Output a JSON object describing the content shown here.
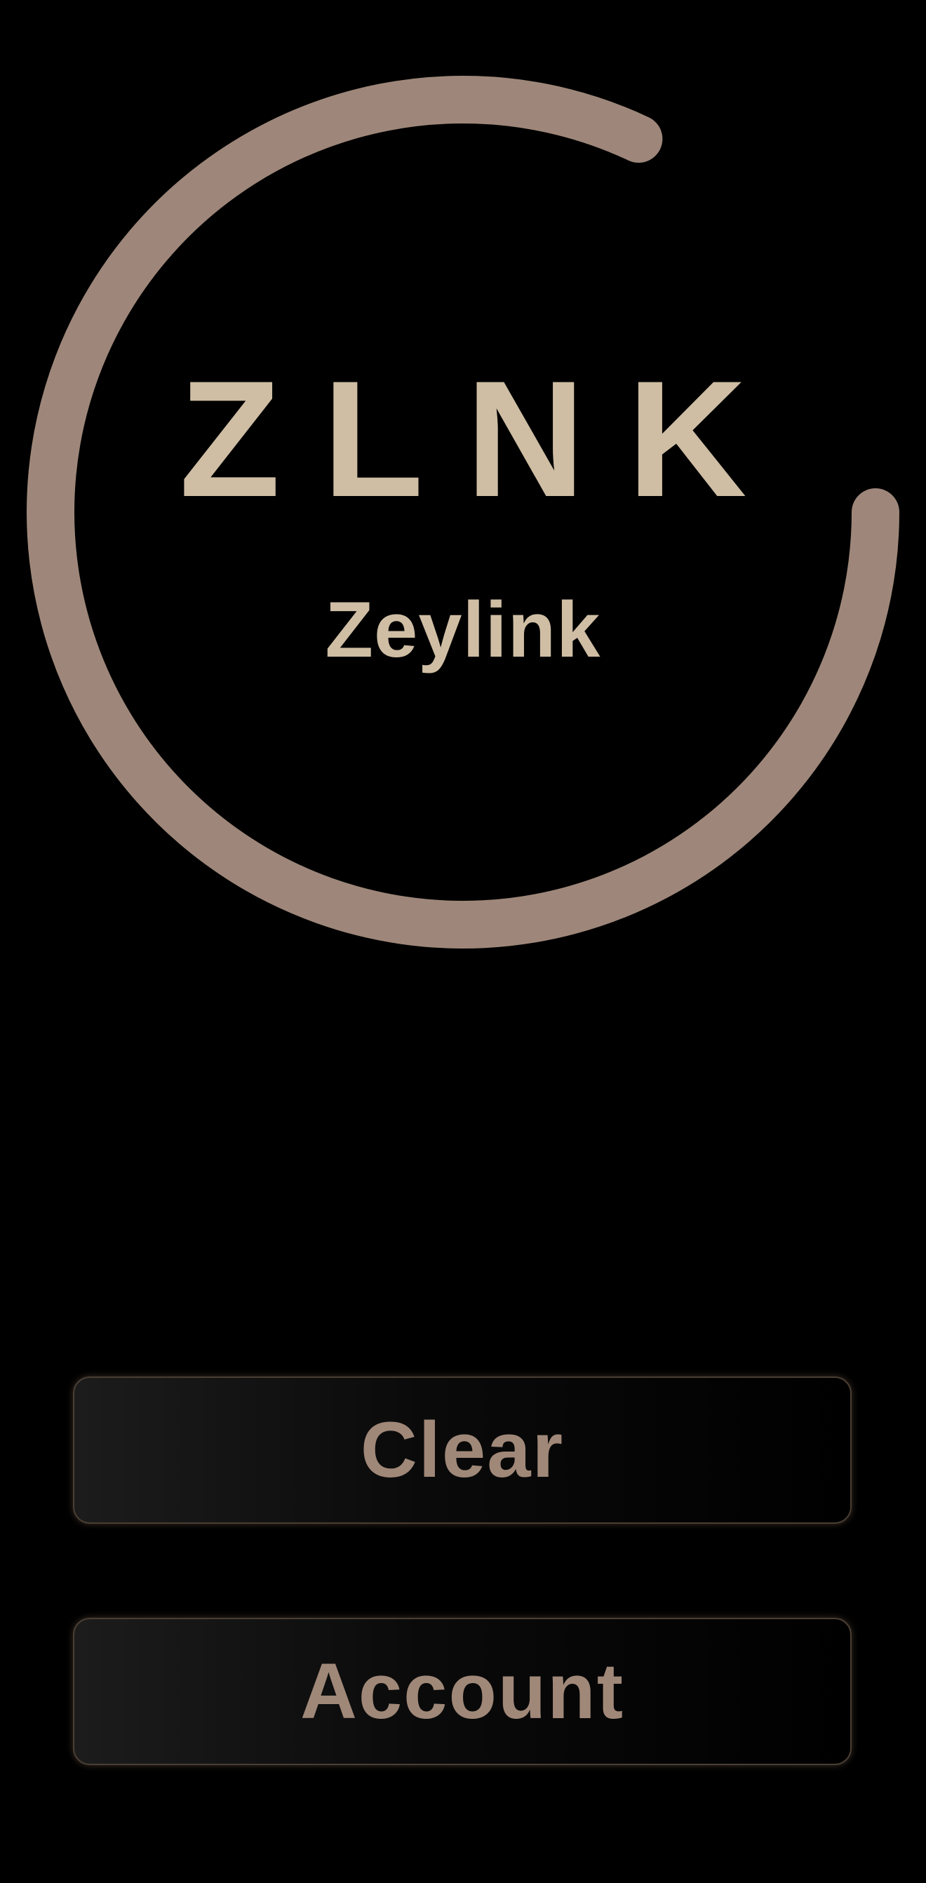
{
  "brand": {
    "logo_letters": "ZLNK",
    "app_name": "Zeylink"
  },
  "progress_ring": {
    "fraction": 0.82,
    "color": "#9e877a"
  },
  "actions": {
    "clear_label": "Clear",
    "account_label": "Account"
  },
  "colors": {
    "background": "#000000",
    "logo_text": "#cfbea4",
    "button_text": "#a08879",
    "button_border": "#4a3e33"
  }
}
